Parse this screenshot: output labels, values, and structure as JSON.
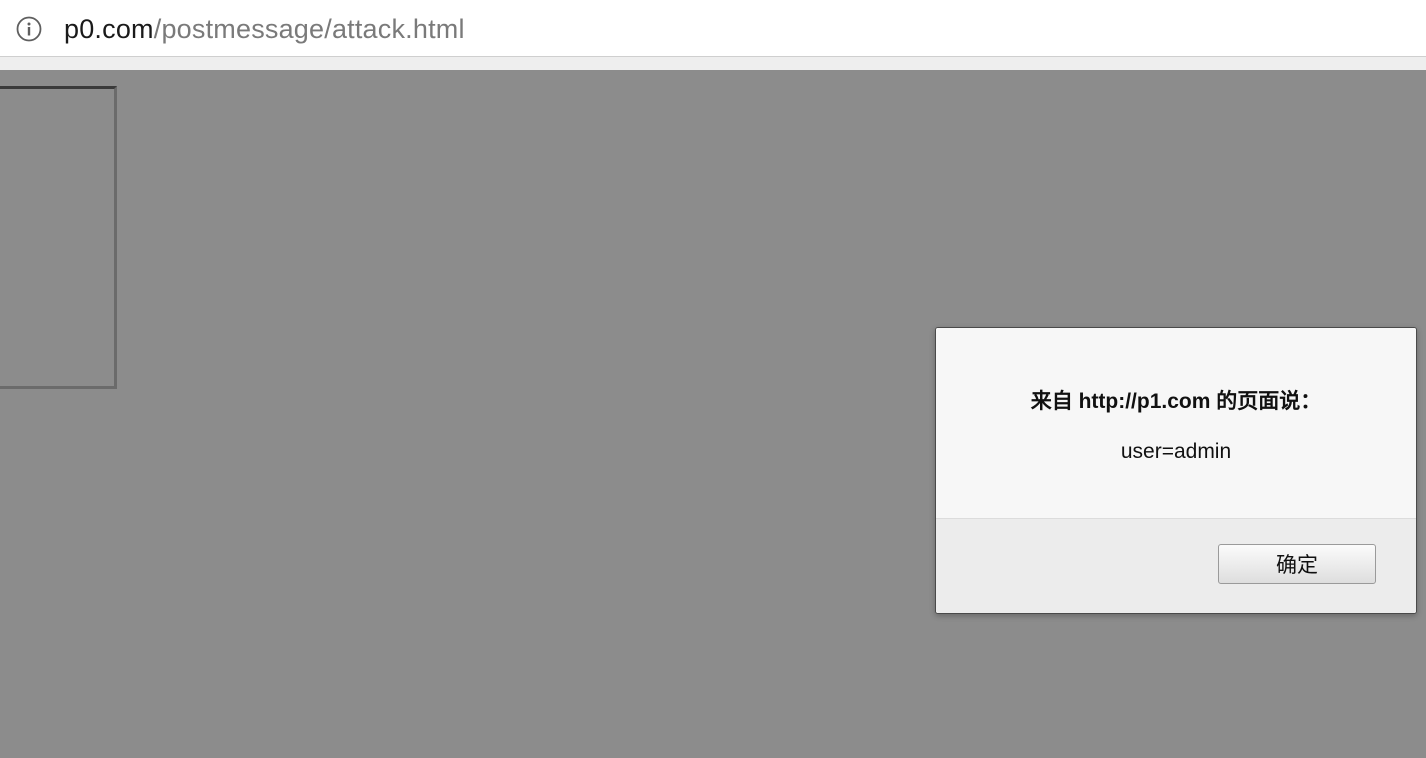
{
  "browser": {
    "url_host": "p0.com",
    "url_path": "/postmessage/attack.html",
    "icon": "info-icon"
  },
  "alert_dialog": {
    "title": "来自 http://p1.com 的页面说：",
    "message": "user=admin",
    "ok_label": "确定"
  },
  "colors": {
    "overlay": "#8c8c8c",
    "dialog_bg": "#f7f7f7",
    "footer_bg": "#ececec"
  }
}
